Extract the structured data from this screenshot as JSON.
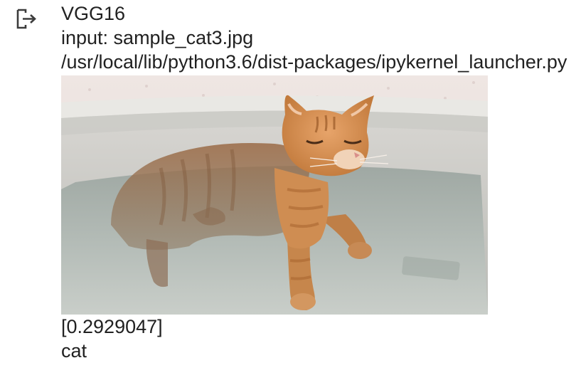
{
  "output": {
    "icon": "output-arrow-icon",
    "model_name": "VGG16",
    "input_line": "input: sample_cat3.jpg",
    "warning_line": "/usr/local/lib/python3.6/dist-packages/ipykernel_launcher.py",
    "image": {
      "subject": "orange tabby cat standing in a bathtub with water"
    },
    "prediction_score": "[0.2929047]",
    "prediction_label": "cat"
  }
}
